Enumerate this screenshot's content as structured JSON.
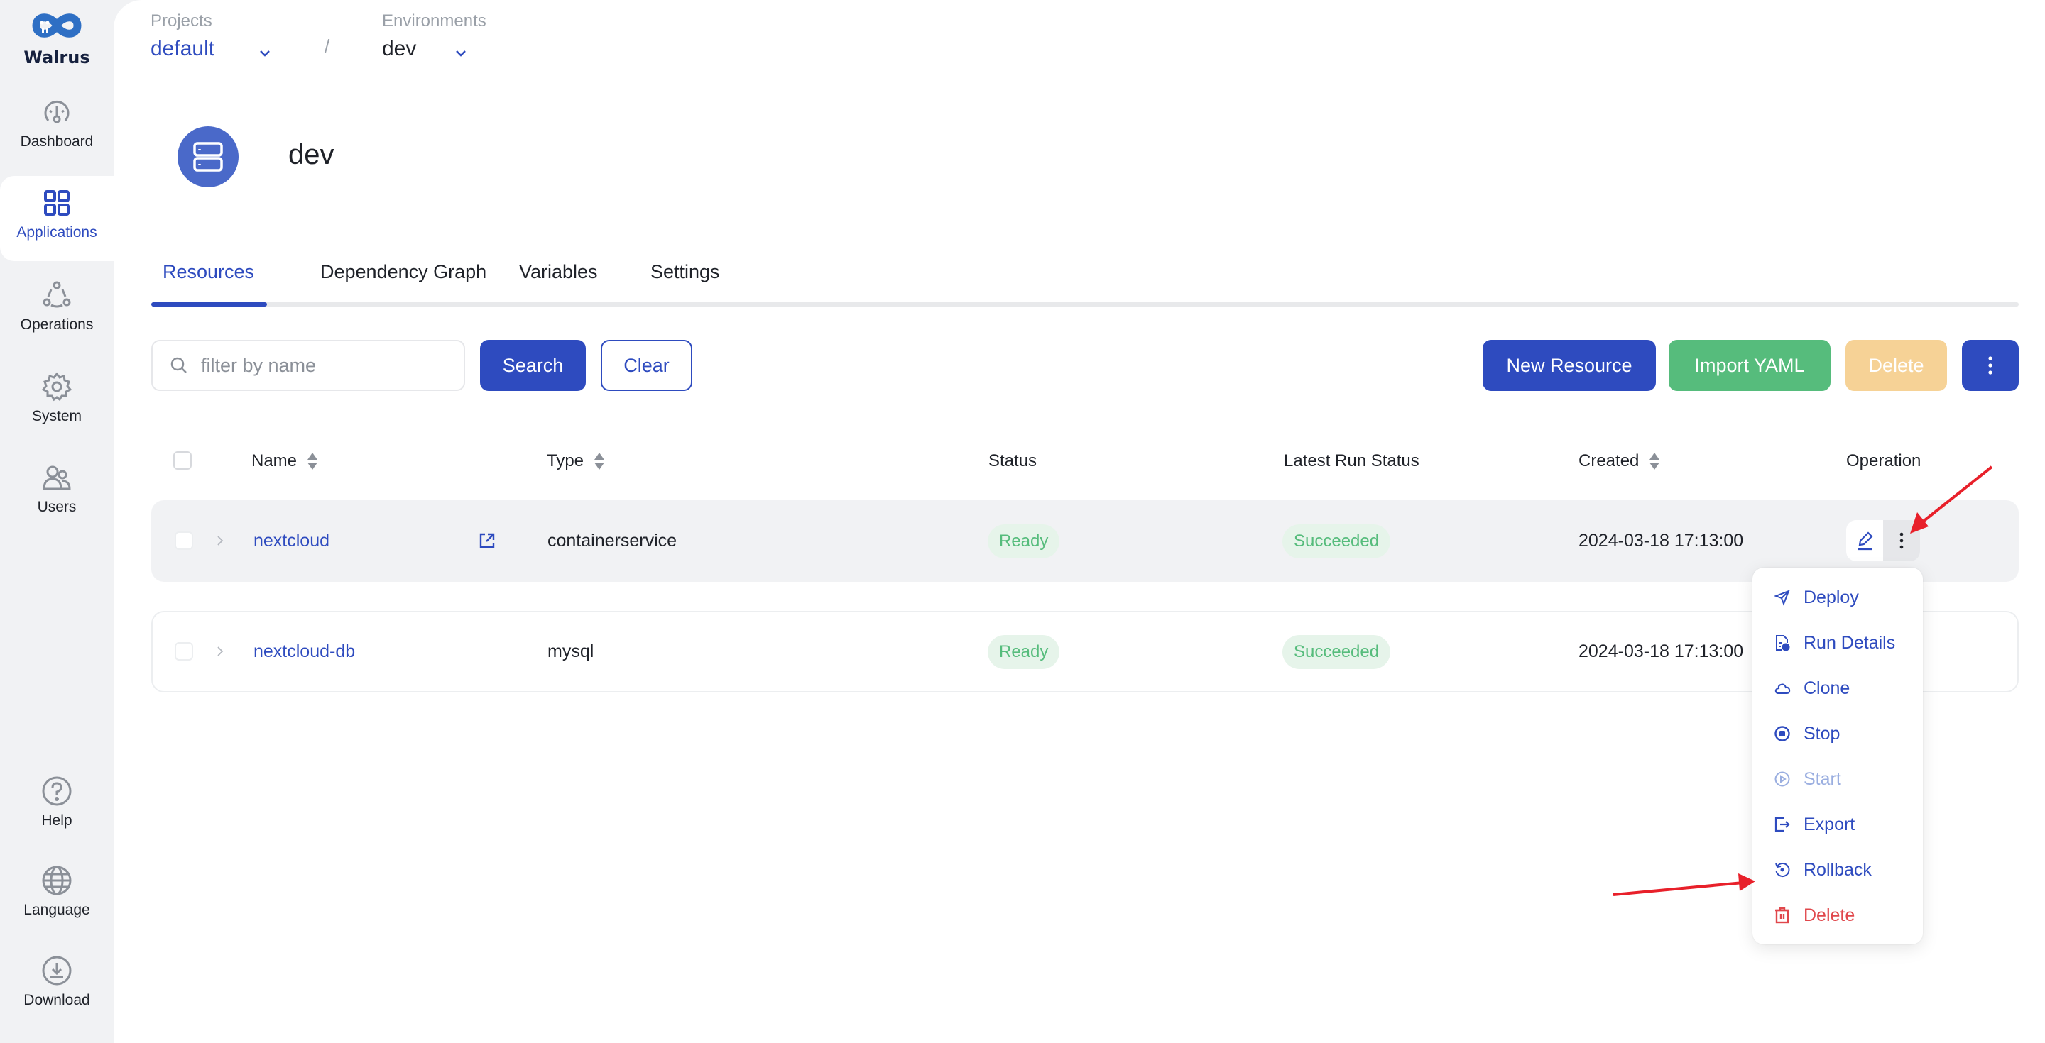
{
  "brand": {
    "name": "Walrus",
    "color": "#2e6fc4"
  },
  "sidebar": {
    "items": [
      {
        "label": "Dashboard",
        "icon": "dashboard-icon",
        "active": false
      },
      {
        "label": "Applications",
        "icon": "applications-grid-icon",
        "active": true
      },
      {
        "label": "Operations",
        "icon": "operations-icon",
        "active": false
      },
      {
        "label": "System",
        "icon": "gear-icon",
        "active": false
      },
      {
        "label": "Users",
        "icon": "users-icon",
        "active": false
      }
    ],
    "bottom_items": [
      {
        "label": "Help",
        "icon": "help-icon"
      },
      {
        "label": "Language",
        "icon": "globe-icon"
      },
      {
        "label": "Download",
        "icon": "download-icon"
      }
    ]
  },
  "breadcrumb": {
    "project_label": "Projects",
    "project_value": "default",
    "separator": "/",
    "env_label": "Environments",
    "env_value": "dev"
  },
  "environment": {
    "title": "dev",
    "icon": "server-icon"
  },
  "tabs": [
    {
      "label": "Resources",
      "active": true
    },
    {
      "label": "Dependency Graph",
      "active": false
    },
    {
      "label": "Variables",
      "active": false
    },
    {
      "label": "Settings",
      "active": false
    }
  ],
  "toolbar": {
    "search_placeholder": "filter by name",
    "search_value": "",
    "search_label": "Search",
    "clear_label": "Clear",
    "new_resource_label": "New Resource",
    "import_yaml_label": "Import YAML",
    "delete_label": "Delete",
    "more_icon": "more-vertical-icon"
  },
  "table": {
    "columns": [
      "Name",
      "Type",
      "Status",
      "Latest Run Status",
      "Created",
      "Operation"
    ],
    "sortable": [
      "Name",
      "Type",
      "Created"
    ],
    "rows": [
      {
        "name": "nextcloud",
        "has_external_link": true,
        "type": "containerservice",
        "status": "Ready",
        "latest_run_status": "Succeeded",
        "created": "2024-03-18 17:13:00"
      },
      {
        "name": "nextcloud-db",
        "has_external_link": false,
        "type": "mysql",
        "status": "Ready",
        "latest_run_status": "Succeeded",
        "created": "2024-03-18 17:13:00"
      }
    ]
  },
  "operation_menu": {
    "items": [
      {
        "label": "Deploy",
        "icon": "send-icon",
        "state": "normal"
      },
      {
        "label": "Run Details",
        "icon": "file-info-icon",
        "state": "normal"
      },
      {
        "label": "Clone",
        "icon": "cloud-icon",
        "state": "normal"
      },
      {
        "label": "Stop",
        "icon": "stop-circle-icon",
        "state": "normal"
      },
      {
        "label": "Start",
        "icon": "play-circle-icon",
        "state": "disabled"
      },
      {
        "label": "Export",
        "icon": "export-icon",
        "state": "normal"
      },
      {
        "label": "Rollback",
        "icon": "rollback-icon",
        "state": "normal"
      },
      {
        "label": "Delete",
        "icon": "trash-icon",
        "state": "danger"
      }
    ]
  },
  "colors": {
    "primary": "#2e4bbf",
    "success": "#56bc7c",
    "warning_disabled": "#f6d296",
    "danger": "#e0474b",
    "annotation": "#e8202a"
  }
}
